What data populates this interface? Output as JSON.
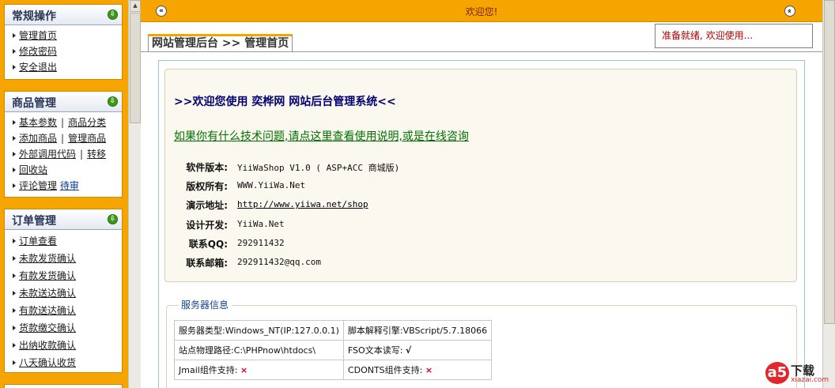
{
  "sidebar": {
    "sections": {
      "general": {
        "title": "常规操作",
        "items": [
          "管理首页",
          "修改密码",
          "安全退出"
        ]
      },
      "products": {
        "title": "商品管理",
        "rows": [
          [
            "基本参数",
            "商品分类"
          ],
          [
            "添加商品",
            "管理商品"
          ],
          [
            "外部调用代码",
            "转移"
          ],
          [
            "回收站"
          ],
          [
            "评论管理",
            "待审"
          ]
        ]
      },
      "orders": {
        "title": "订单管理",
        "items": [
          "订单查看",
          "未款发货确认",
          "有款发货确认",
          "未款送达确认",
          "有款送达确认",
          "货款缴交确认",
          "出纳收款确认",
          "八天确认收货"
        ]
      }
    }
  },
  "topbar": {
    "welcome": "欢迎您!",
    "left_button": "«",
    "right_button": "»"
  },
  "tab": {
    "label": "网站管理后台 >> 管理首页"
  },
  "status": "准备就绪, 欢迎使用...",
  "main": {
    "welcome_title": ">>欢迎您使用 奕桦网 网站后台管理系统<<",
    "help_link": "如果你有什么技术问题,请点这里查看使用说明,或是在线咨询",
    "software": [
      {
        "label": "软件版本:",
        "value": "YiiWaShop V1.0 ( ASP+ACC 商城版)"
      },
      {
        "label": "版权所有:",
        "value": "WWW.YiiWa.Net"
      },
      {
        "label": "演示地址:",
        "value": "http://www.yiiwa.net/shop"
      },
      {
        "label": "设计开发:",
        "value": "YiiWa.Net"
      },
      {
        "label": "联系QQ:",
        "value": "292911432"
      },
      {
        "label": "联系邮箱:",
        "value": "292911432@qq.com"
      }
    ]
  },
  "server": {
    "legend": "服务器信息",
    "rows": [
      {
        "label_a": "服务器类型:",
        "value_a": "Windows_NT(IP:127.0.0.1)",
        "label_b": "脚本解释引擎:",
        "value_b": "VBScript/5.7.18066"
      },
      {
        "label_a": "站点物理路径:",
        "value_a": "C:\\PHPnow\\htdocs\\",
        "label_b": "FSO文本读写:",
        "value_b": "√"
      },
      {
        "label_a": "Jmail组件支持:",
        "value_a": "×",
        "label_b": "CDONTS组件支持:",
        "value_b": "×"
      }
    ]
  },
  "watermark": {
    "badge": "a5",
    "text": "下载",
    "site": "xiazai.com"
  }
}
